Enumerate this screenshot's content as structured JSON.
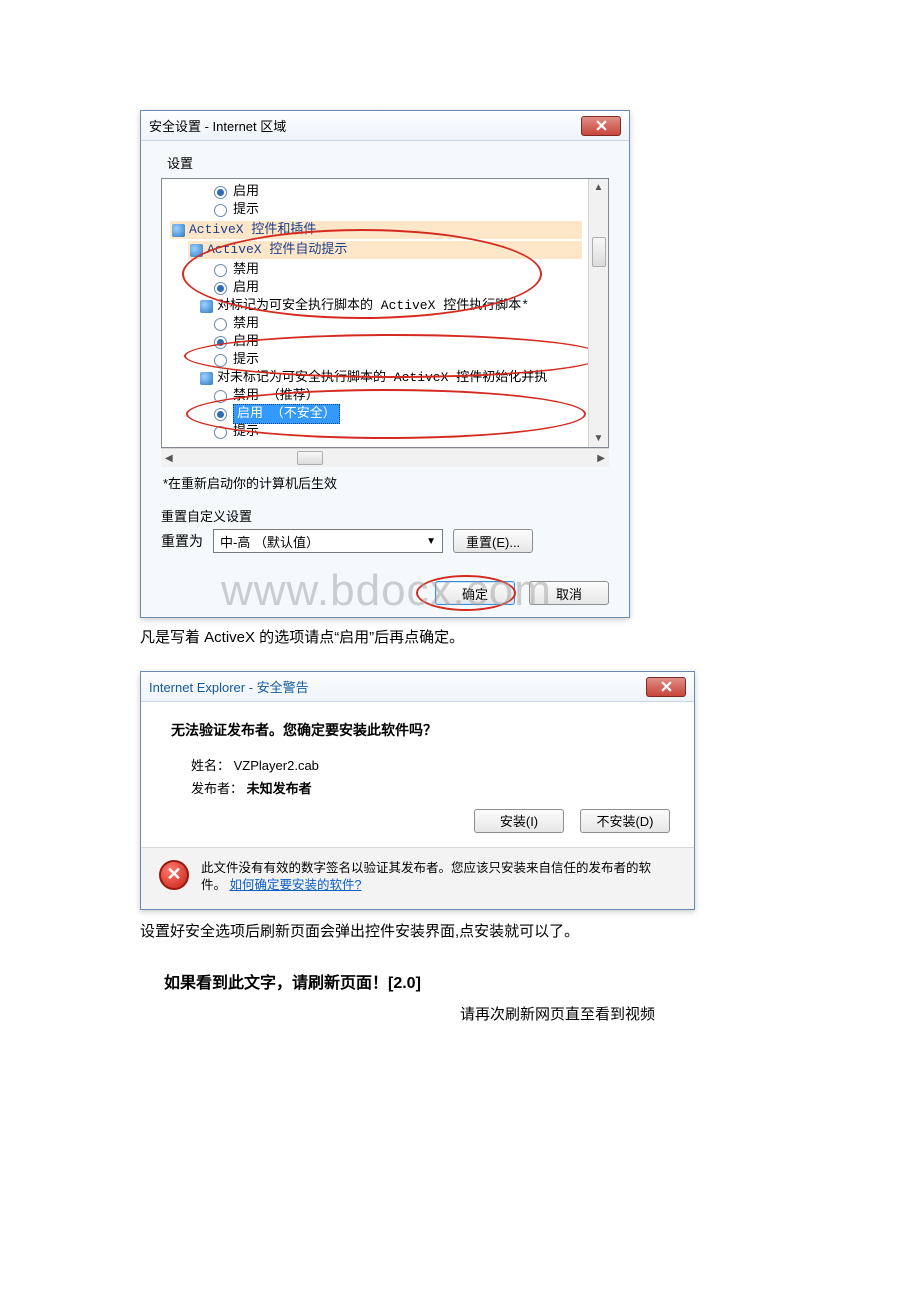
{
  "security_dialog": {
    "title": "安全设置 - Internet 区域",
    "settings_label": "设置",
    "options": {
      "opt1": "启用",
      "opt2": "提示",
      "cat1": "ActiveX 控件和插件",
      "cat2": "ActiveX 控件自动提示",
      "opt3": "禁用",
      "opt4": "启用",
      "cat3": "对标记为可安全执行脚本的 ActiveX 控件执行脚本*",
      "opt5": "禁用",
      "opt6": "启用",
      "opt7": "提示",
      "cat4": "对未标记为可安全执行脚本的 ActiveX 控件初始化并执",
      "opt8": "禁用 （推荐）",
      "opt9_sel": "启用 （不安全）",
      "opt10": "提示"
    },
    "restart_note": "*在重新启动你的计算机后生效",
    "reset_title": "重置自定义设置",
    "reset_label": "重置为",
    "reset_value": "中-高 （默认值）",
    "reset_button": "重置(E)...",
    "ok": "确定",
    "cancel": "取消"
  },
  "caption1": "凡是写着 ActiveX 的选项请点“启用”后再点确定。",
  "ie_warning": {
    "title": "Internet Explorer - 安全警告",
    "question": "无法验证发布者。您确定要安装此软件吗？",
    "name_label": "姓名：",
    "name_value": "VZPlayer2.cab",
    "publisher_label": "发布者：",
    "publisher_value": "未知发布者",
    "install": "安装(I)",
    "dont_install": "不安装(D)",
    "footer_text": "此文件没有有效的数字签名以验证其发布者。您应该只安装来自信任的发布者的软件。",
    "footer_link": "如何确定要安装的软件?"
  },
  "caption2": "设置好安全选项后刷新页面会弹出控件安装界面,点安装就可以了。",
  "refresh_bold": "如果看到此文字，请刷新页面！[2.0]",
  "refresh_sub": "请再次刷新网页直至看到视频",
  "watermark": "www.bdocx.com"
}
